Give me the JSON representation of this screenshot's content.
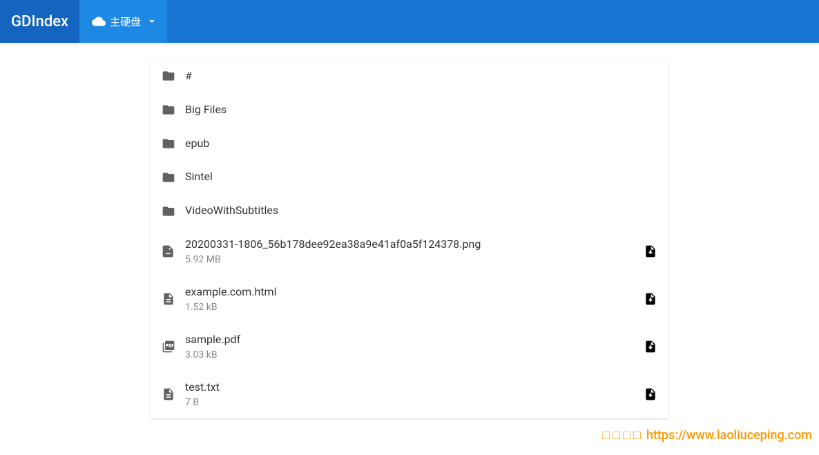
{
  "header": {
    "brand": "GDIndex",
    "drive_label": "主硬盘"
  },
  "folders": [
    {
      "name": "#"
    },
    {
      "name": "Big Files"
    },
    {
      "name": "epub"
    },
    {
      "name": "Sintel"
    },
    {
      "name": "VideoWithSubtitles"
    }
  ],
  "files": [
    {
      "name": "20200331-1806_56b178dee92ea38a9e41af0a5f124378.png",
      "size": "5.92 MB",
      "type": "image"
    },
    {
      "name": "example.com.html",
      "size": "1.52 kB",
      "type": "doc"
    },
    {
      "name": "sample.pdf",
      "size": "3.03 kB",
      "type": "pdf"
    },
    {
      "name": "test.txt",
      "size": "7 B",
      "type": "doc"
    }
  ],
  "watermark": {
    "prefix": "□□□□",
    "text": "https://www.laoliuceping.com"
  }
}
